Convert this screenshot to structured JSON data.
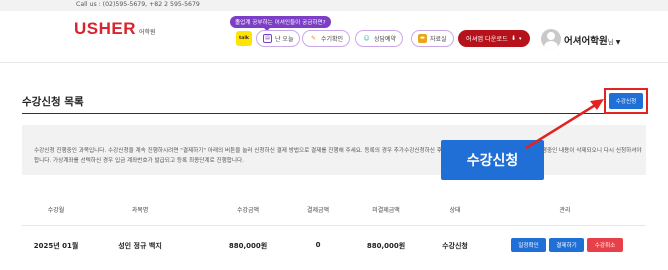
{
  "topbar": {
    "contact": "Call us : (02)595-5679, +82 2 595-5679"
  },
  "header": {
    "logo": "USHER",
    "logo_sub": "어학원",
    "tooltip": "졸업계 공부하는 어셔인들이 궁금하면?",
    "kakao_label": "talk",
    "pills": [
      {
        "label": "난 오늘",
        "icon": "document-icon",
        "color": "#7b3ec4"
      },
      {
        "label": "수기확인",
        "icon": "pencil-icon",
        "color": "#f08a24"
      },
      {
        "label": "상담예약",
        "icon": "person-icon",
        "color": "#2aa7a0"
      },
      {
        "label": "자료실",
        "icon": "folder-icon",
        "color": "#e6a817"
      }
    ],
    "download_label": "어셔앱 다운로드",
    "user_name": "어셔어학원",
    "user_suffix": "님"
  },
  "main": {
    "title": "수강신청 목록",
    "enroll_button": "수강신청",
    "notice": "수강신청 진행중인 과목입니다. 수강신청을 계속 진행하시려면 \"결제하기\" 아래의 버튼을 눌러 신청하신 결제 방법으로 결제를 진행해 주세요. 등록의 경우 추가수강신청하신 후 결제 확인이 되시지 않으면 해당 등록을 진행중인 내용이 삭제되오니 다시 신청하셔야 합니다. 가상계좌를 선택하신 경우 입금 계좌번호가 발급되고 등록 최종단계로 진행합니다.",
    "callout": "수강신청"
  },
  "table": {
    "headers": [
      "수강월",
      "과목명",
      "수강금액",
      "결제금액",
      "미결제금액",
      "상태",
      "관리"
    ],
    "rows": [
      {
        "month": "2025년 01월",
        "course": "성인 정규 백지",
        "fee": "880,000원",
        "paid": "0",
        "unpaid": "880,000원",
        "status": "수강신청",
        "actions": [
          "일정확인",
          "결제하기",
          "수강취소"
        ]
      }
    ]
  },
  "colors": {
    "brand_red": "#d9232d",
    "primary_blue": "#1f6fd6",
    "highlight_red": "#e32222",
    "cancel_red": "#e8404a"
  }
}
